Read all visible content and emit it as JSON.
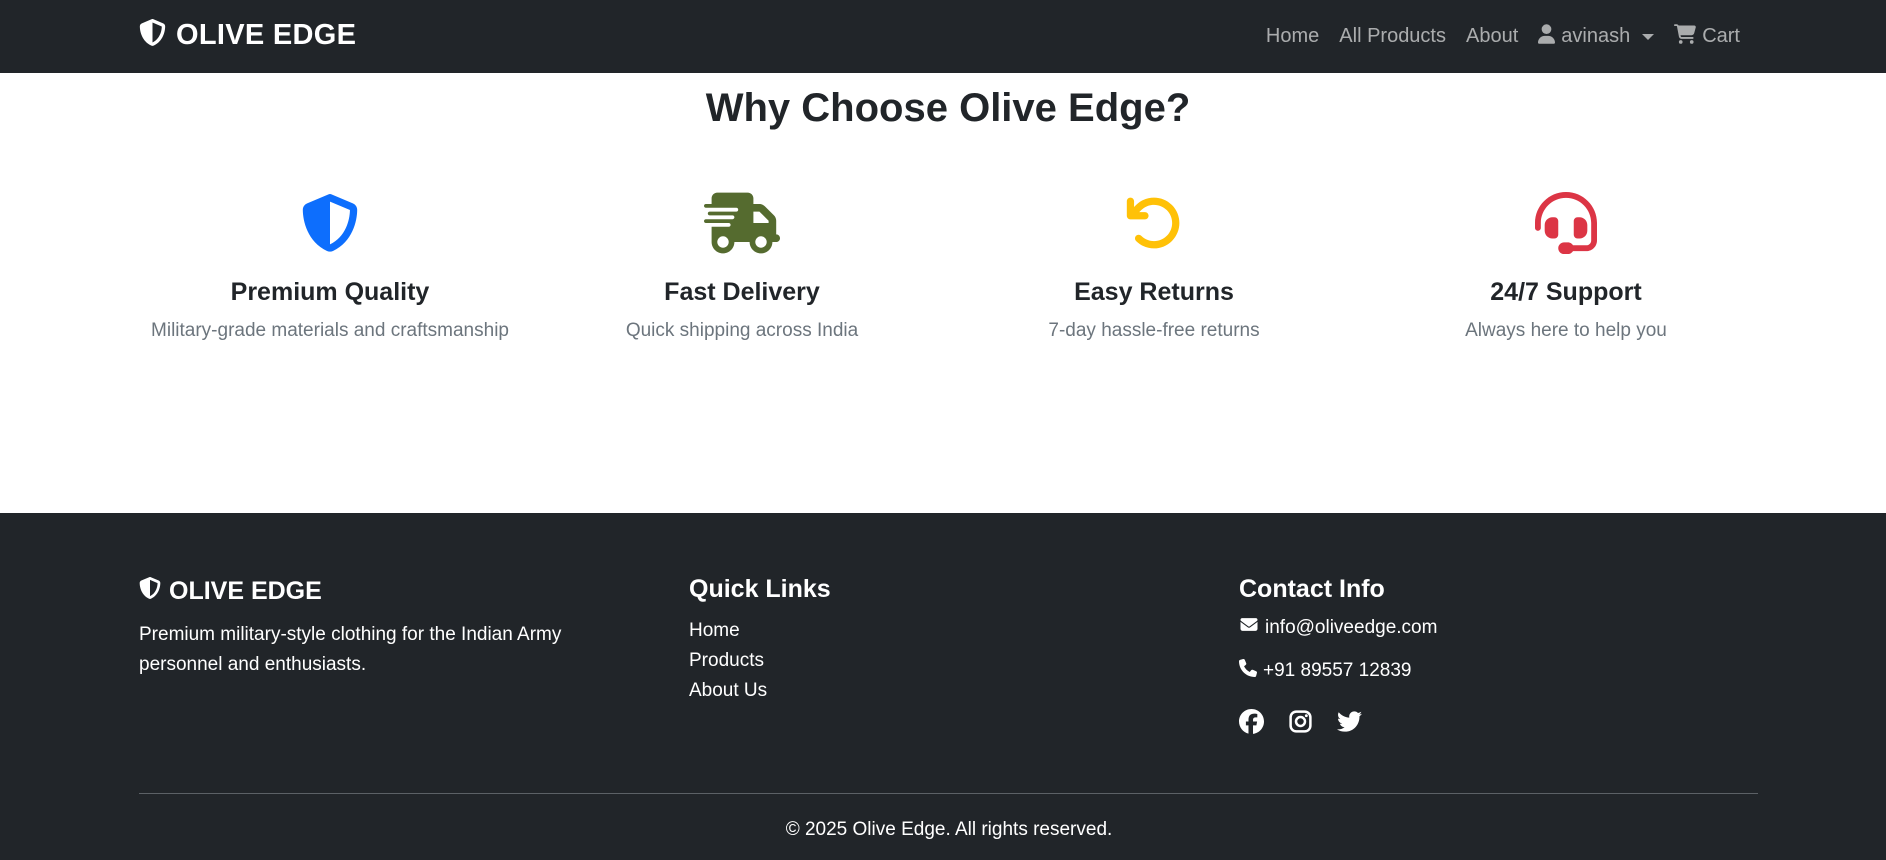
{
  "navbar": {
    "brand": "OLIVE EDGE",
    "links": [
      {
        "label": "Home"
      },
      {
        "label": "All Products"
      },
      {
        "label": "About"
      }
    ],
    "user": {
      "label": "avinash"
    },
    "cart": {
      "label": "Cart"
    }
  },
  "features": {
    "title": "Why Choose Olive Edge?",
    "items": [
      {
        "icon": "shield-icon",
        "color": "#0d6efd",
        "title": "Premium Quality",
        "desc": "Military-grade materials and craftsmanship"
      },
      {
        "icon": "truck-fast-icon",
        "color": "#556b2f",
        "title": "Fast Delivery",
        "desc": "Quick shipping across India"
      },
      {
        "icon": "undo-icon",
        "color": "#ffc107",
        "title": "Easy Returns",
        "desc": "7-day hassle-free returns"
      },
      {
        "icon": "headset-icon",
        "color": "#dc3545",
        "title": "24/7 Support",
        "desc": "Always here to help you"
      }
    ]
  },
  "footer": {
    "brand": "OLIVE EDGE",
    "description": "Premium military-style clothing for the Indian Army personnel and enthusiasts.",
    "quick_links": {
      "title": "Quick Links",
      "items": [
        {
          "label": "Home"
        },
        {
          "label": "Products"
        },
        {
          "label": "About Us"
        }
      ]
    },
    "contact": {
      "title": "Contact Info",
      "email": "info@oliveedge.com",
      "phone": "+91 89557 12839",
      "socials": [
        "facebook-icon",
        "instagram-icon",
        "twitter-icon"
      ]
    },
    "copyright": "© 2025 Olive Edge. All rights reserved."
  }
}
